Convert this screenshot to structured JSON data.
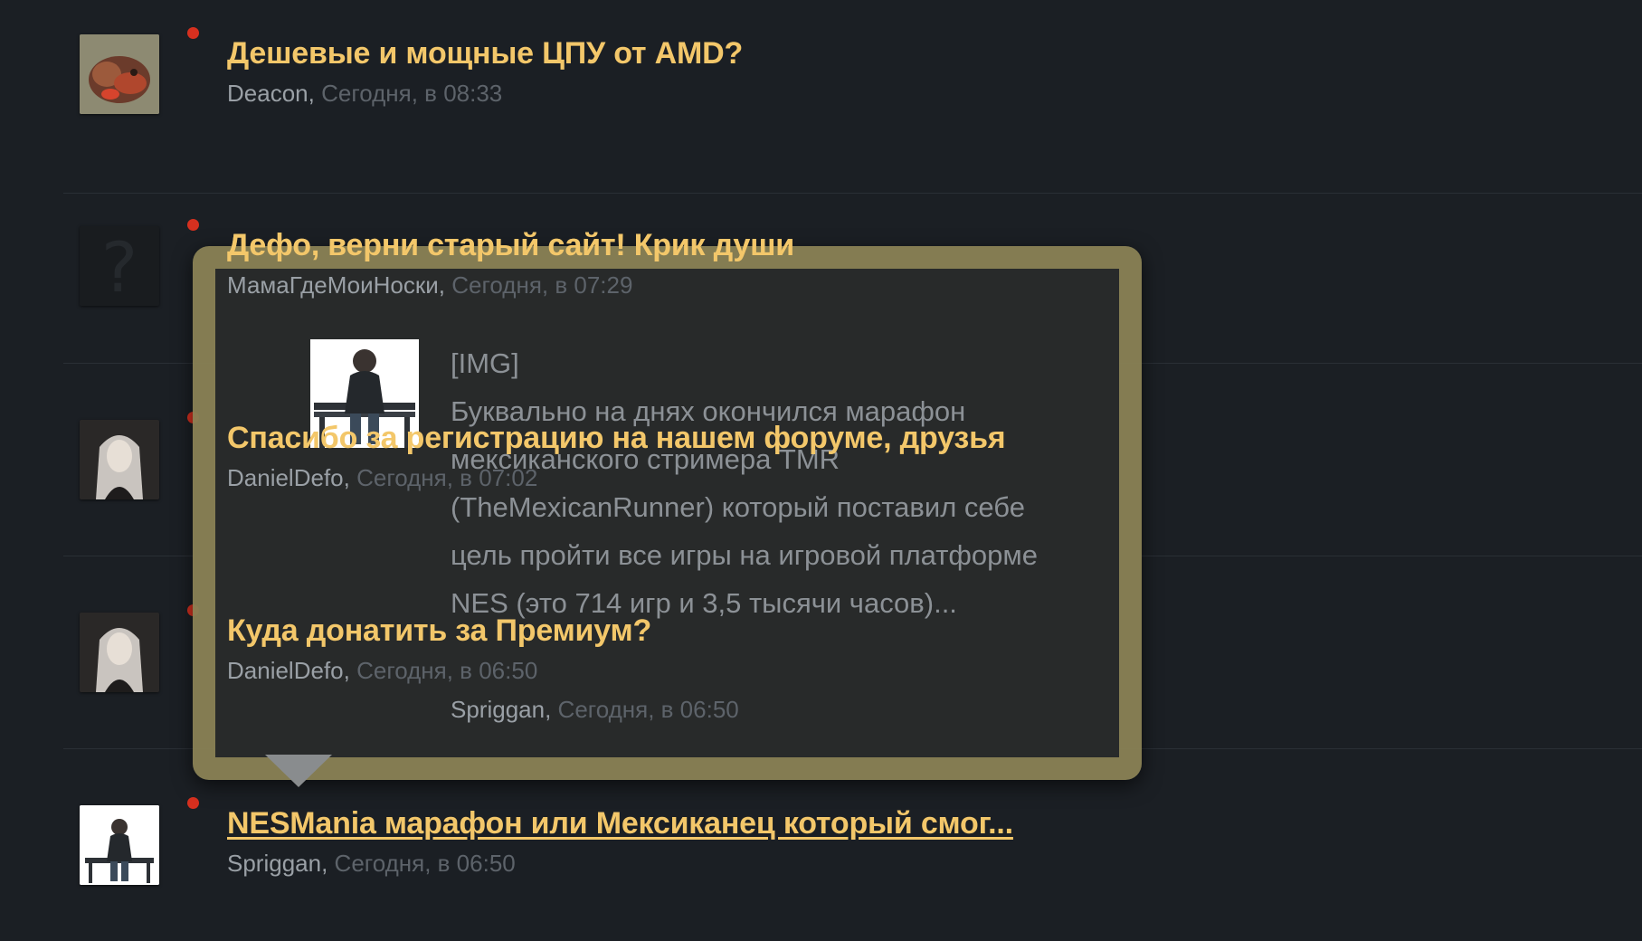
{
  "threads": [
    {
      "title": "Дешевые и мощные ЦПУ от AMD?",
      "author": "Deacon,",
      "date": "Сегодня, в 08:33",
      "avatar": "wolf-avatar"
    },
    {
      "title": "Дефо, верни старый сайт! Крик души",
      "author": "МамаГдеМоиНоски,",
      "date": "Сегодня, в 07:29",
      "avatar": "question-mark-avatar"
    },
    {
      "title": "Спасибо за регистрацию на нашем форуме, друзья",
      "author": "DanielDefo,",
      "date": "Сегодня, в 07:02",
      "avatar": "white-hair-avatar"
    },
    {
      "title": "Куда донатить за Премиум?",
      "author": "DanielDefo,",
      "date": "Сегодня, в 06:50",
      "avatar": "white-hair-avatar"
    },
    {
      "title": "NESMania марафон или Мексиканец который смог...",
      "author": "Spriggan,",
      "date": "Сегодня, в 06:50",
      "avatar": "sitting-man-avatar"
    }
  ],
  "preview": {
    "img_tag": "[IMG]",
    "text": "Буквально на днях окончился марафон мексиканского стримера TMR (TheMexicanRunner) который поставил себе цель пройти все игры на игровой платформе NES (это 714 игр и 3,5 тысячи часов)...",
    "author": "Spriggan,",
    "date": "Сегодня, в 06:50"
  },
  "colors": {
    "title": "#f3c76a",
    "dot": "#d6301f",
    "popup_frame": "#888054"
  }
}
